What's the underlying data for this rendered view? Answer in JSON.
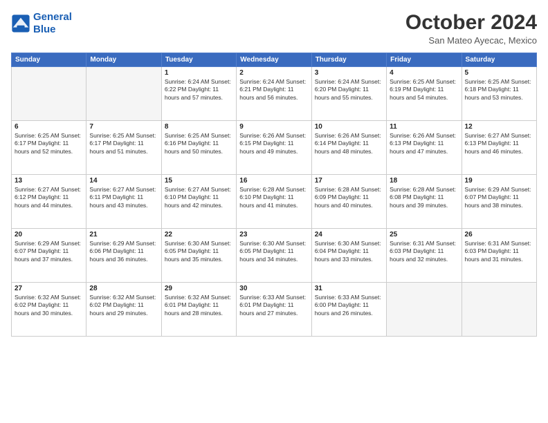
{
  "header": {
    "logo_line1": "General",
    "logo_line2": "Blue",
    "month_title": "October 2024",
    "location": "San Mateo Ayecac, Mexico"
  },
  "days_of_week": [
    "Sunday",
    "Monday",
    "Tuesday",
    "Wednesday",
    "Thursday",
    "Friday",
    "Saturday"
  ],
  "weeks": [
    [
      {
        "num": "",
        "info": ""
      },
      {
        "num": "",
        "info": ""
      },
      {
        "num": "1",
        "info": "Sunrise: 6:24 AM\nSunset: 6:22 PM\nDaylight: 11 hours and 57 minutes."
      },
      {
        "num": "2",
        "info": "Sunrise: 6:24 AM\nSunset: 6:21 PM\nDaylight: 11 hours and 56 minutes."
      },
      {
        "num": "3",
        "info": "Sunrise: 6:24 AM\nSunset: 6:20 PM\nDaylight: 11 hours and 55 minutes."
      },
      {
        "num": "4",
        "info": "Sunrise: 6:25 AM\nSunset: 6:19 PM\nDaylight: 11 hours and 54 minutes."
      },
      {
        "num": "5",
        "info": "Sunrise: 6:25 AM\nSunset: 6:18 PM\nDaylight: 11 hours and 53 minutes."
      }
    ],
    [
      {
        "num": "6",
        "info": "Sunrise: 6:25 AM\nSunset: 6:17 PM\nDaylight: 11 hours and 52 minutes."
      },
      {
        "num": "7",
        "info": "Sunrise: 6:25 AM\nSunset: 6:17 PM\nDaylight: 11 hours and 51 minutes."
      },
      {
        "num": "8",
        "info": "Sunrise: 6:25 AM\nSunset: 6:16 PM\nDaylight: 11 hours and 50 minutes."
      },
      {
        "num": "9",
        "info": "Sunrise: 6:26 AM\nSunset: 6:15 PM\nDaylight: 11 hours and 49 minutes."
      },
      {
        "num": "10",
        "info": "Sunrise: 6:26 AM\nSunset: 6:14 PM\nDaylight: 11 hours and 48 minutes."
      },
      {
        "num": "11",
        "info": "Sunrise: 6:26 AM\nSunset: 6:13 PM\nDaylight: 11 hours and 47 minutes."
      },
      {
        "num": "12",
        "info": "Sunrise: 6:27 AM\nSunset: 6:13 PM\nDaylight: 11 hours and 46 minutes."
      }
    ],
    [
      {
        "num": "13",
        "info": "Sunrise: 6:27 AM\nSunset: 6:12 PM\nDaylight: 11 hours and 44 minutes."
      },
      {
        "num": "14",
        "info": "Sunrise: 6:27 AM\nSunset: 6:11 PM\nDaylight: 11 hours and 43 minutes."
      },
      {
        "num": "15",
        "info": "Sunrise: 6:27 AM\nSunset: 6:10 PM\nDaylight: 11 hours and 42 minutes."
      },
      {
        "num": "16",
        "info": "Sunrise: 6:28 AM\nSunset: 6:10 PM\nDaylight: 11 hours and 41 minutes."
      },
      {
        "num": "17",
        "info": "Sunrise: 6:28 AM\nSunset: 6:09 PM\nDaylight: 11 hours and 40 minutes."
      },
      {
        "num": "18",
        "info": "Sunrise: 6:28 AM\nSunset: 6:08 PM\nDaylight: 11 hours and 39 minutes."
      },
      {
        "num": "19",
        "info": "Sunrise: 6:29 AM\nSunset: 6:07 PM\nDaylight: 11 hours and 38 minutes."
      }
    ],
    [
      {
        "num": "20",
        "info": "Sunrise: 6:29 AM\nSunset: 6:07 PM\nDaylight: 11 hours and 37 minutes."
      },
      {
        "num": "21",
        "info": "Sunrise: 6:29 AM\nSunset: 6:06 PM\nDaylight: 11 hours and 36 minutes."
      },
      {
        "num": "22",
        "info": "Sunrise: 6:30 AM\nSunset: 6:05 PM\nDaylight: 11 hours and 35 minutes."
      },
      {
        "num": "23",
        "info": "Sunrise: 6:30 AM\nSunset: 6:05 PM\nDaylight: 11 hours and 34 minutes."
      },
      {
        "num": "24",
        "info": "Sunrise: 6:30 AM\nSunset: 6:04 PM\nDaylight: 11 hours and 33 minutes."
      },
      {
        "num": "25",
        "info": "Sunrise: 6:31 AM\nSunset: 6:03 PM\nDaylight: 11 hours and 32 minutes."
      },
      {
        "num": "26",
        "info": "Sunrise: 6:31 AM\nSunset: 6:03 PM\nDaylight: 11 hours and 31 minutes."
      }
    ],
    [
      {
        "num": "27",
        "info": "Sunrise: 6:32 AM\nSunset: 6:02 PM\nDaylight: 11 hours and 30 minutes."
      },
      {
        "num": "28",
        "info": "Sunrise: 6:32 AM\nSunset: 6:02 PM\nDaylight: 11 hours and 29 minutes."
      },
      {
        "num": "29",
        "info": "Sunrise: 6:32 AM\nSunset: 6:01 PM\nDaylight: 11 hours and 28 minutes."
      },
      {
        "num": "30",
        "info": "Sunrise: 6:33 AM\nSunset: 6:01 PM\nDaylight: 11 hours and 27 minutes."
      },
      {
        "num": "31",
        "info": "Sunrise: 6:33 AM\nSunset: 6:00 PM\nDaylight: 11 hours and 26 minutes."
      },
      {
        "num": "",
        "info": ""
      },
      {
        "num": "",
        "info": ""
      }
    ]
  ]
}
